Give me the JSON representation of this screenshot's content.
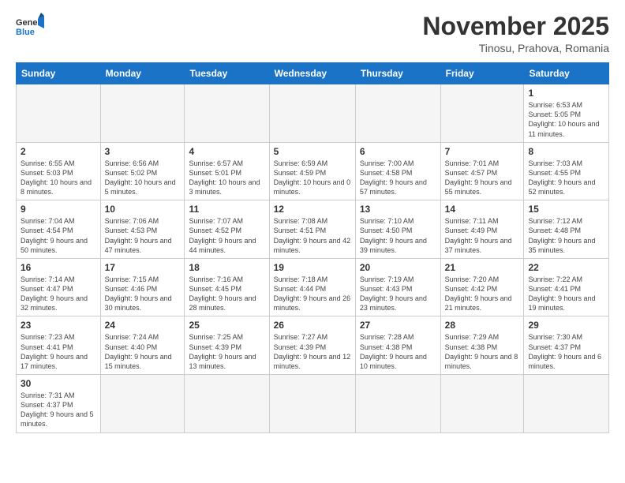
{
  "logo": {
    "general": "General",
    "blue": "Blue"
  },
  "header": {
    "month": "November 2025",
    "location": "Tinosu, Prahova, Romania"
  },
  "weekdays": [
    "Sunday",
    "Monday",
    "Tuesday",
    "Wednesday",
    "Thursday",
    "Friday",
    "Saturday"
  ],
  "weeks": [
    [
      {
        "day": "",
        "info": ""
      },
      {
        "day": "",
        "info": ""
      },
      {
        "day": "",
        "info": ""
      },
      {
        "day": "",
        "info": ""
      },
      {
        "day": "",
        "info": ""
      },
      {
        "day": "",
        "info": ""
      },
      {
        "day": "1",
        "info": "Sunrise: 6:53 AM\nSunset: 5:05 PM\nDaylight: 10 hours and 11 minutes."
      }
    ],
    [
      {
        "day": "2",
        "info": "Sunrise: 6:55 AM\nSunset: 5:03 PM\nDaylight: 10 hours and 8 minutes."
      },
      {
        "day": "3",
        "info": "Sunrise: 6:56 AM\nSunset: 5:02 PM\nDaylight: 10 hours and 5 minutes."
      },
      {
        "day": "4",
        "info": "Sunrise: 6:57 AM\nSunset: 5:01 PM\nDaylight: 10 hours and 3 minutes."
      },
      {
        "day": "5",
        "info": "Sunrise: 6:59 AM\nSunset: 4:59 PM\nDaylight: 10 hours and 0 minutes."
      },
      {
        "day": "6",
        "info": "Sunrise: 7:00 AM\nSunset: 4:58 PM\nDaylight: 9 hours and 57 minutes."
      },
      {
        "day": "7",
        "info": "Sunrise: 7:01 AM\nSunset: 4:57 PM\nDaylight: 9 hours and 55 minutes."
      },
      {
        "day": "8",
        "info": "Sunrise: 7:03 AM\nSunset: 4:55 PM\nDaylight: 9 hours and 52 minutes."
      }
    ],
    [
      {
        "day": "9",
        "info": "Sunrise: 7:04 AM\nSunset: 4:54 PM\nDaylight: 9 hours and 50 minutes."
      },
      {
        "day": "10",
        "info": "Sunrise: 7:06 AM\nSunset: 4:53 PM\nDaylight: 9 hours and 47 minutes."
      },
      {
        "day": "11",
        "info": "Sunrise: 7:07 AM\nSunset: 4:52 PM\nDaylight: 9 hours and 44 minutes."
      },
      {
        "day": "12",
        "info": "Sunrise: 7:08 AM\nSunset: 4:51 PM\nDaylight: 9 hours and 42 minutes."
      },
      {
        "day": "13",
        "info": "Sunrise: 7:10 AM\nSunset: 4:50 PM\nDaylight: 9 hours and 39 minutes."
      },
      {
        "day": "14",
        "info": "Sunrise: 7:11 AM\nSunset: 4:49 PM\nDaylight: 9 hours and 37 minutes."
      },
      {
        "day": "15",
        "info": "Sunrise: 7:12 AM\nSunset: 4:48 PM\nDaylight: 9 hours and 35 minutes."
      }
    ],
    [
      {
        "day": "16",
        "info": "Sunrise: 7:14 AM\nSunset: 4:47 PM\nDaylight: 9 hours and 32 minutes."
      },
      {
        "day": "17",
        "info": "Sunrise: 7:15 AM\nSunset: 4:46 PM\nDaylight: 9 hours and 30 minutes."
      },
      {
        "day": "18",
        "info": "Sunrise: 7:16 AM\nSunset: 4:45 PM\nDaylight: 9 hours and 28 minutes."
      },
      {
        "day": "19",
        "info": "Sunrise: 7:18 AM\nSunset: 4:44 PM\nDaylight: 9 hours and 26 minutes."
      },
      {
        "day": "20",
        "info": "Sunrise: 7:19 AM\nSunset: 4:43 PM\nDaylight: 9 hours and 23 minutes."
      },
      {
        "day": "21",
        "info": "Sunrise: 7:20 AM\nSunset: 4:42 PM\nDaylight: 9 hours and 21 minutes."
      },
      {
        "day": "22",
        "info": "Sunrise: 7:22 AM\nSunset: 4:41 PM\nDaylight: 9 hours and 19 minutes."
      }
    ],
    [
      {
        "day": "23",
        "info": "Sunrise: 7:23 AM\nSunset: 4:41 PM\nDaylight: 9 hours and 17 minutes."
      },
      {
        "day": "24",
        "info": "Sunrise: 7:24 AM\nSunset: 4:40 PM\nDaylight: 9 hours and 15 minutes."
      },
      {
        "day": "25",
        "info": "Sunrise: 7:25 AM\nSunset: 4:39 PM\nDaylight: 9 hours and 13 minutes."
      },
      {
        "day": "26",
        "info": "Sunrise: 7:27 AM\nSunset: 4:39 PM\nDaylight: 9 hours and 12 minutes."
      },
      {
        "day": "27",
        "info": "Sunrise: 7:28 AM\nSunset: 4:38 PM\nDaylight: 9 hours and 10 minutes."
      },
      {
        "day": "28",
        "info": "Sunrise: 7:29 AM\nSunset: 4:38 PM\nDaylight: 9 hours and 8 minutes."
      },
      {
        "day": "29",
        "info": "Sunrise: 7:30 AM\nSunset: 4:37 PM\nDaylight: 9 hours and 6 minutes."
      }
    ],
    [
      {
        "day": "30",
        "info": "Sunrise: 7:31 AM\nSunset: 4:37 PM\nDaylight: 9 hours and 5 minutes."
      },
      {
        "day": "",
        "info": ""
      },
      {
        "day": "",
        "info": ""
      },
      {
        "day": "",
        "info": ""
      },
      {
        "day": "",
        "info": ""
      },
      {
        "day": "",
        "info": ""
      },
      {
        "day": "",
        "info": ""
      }
    ]
  ]
}
